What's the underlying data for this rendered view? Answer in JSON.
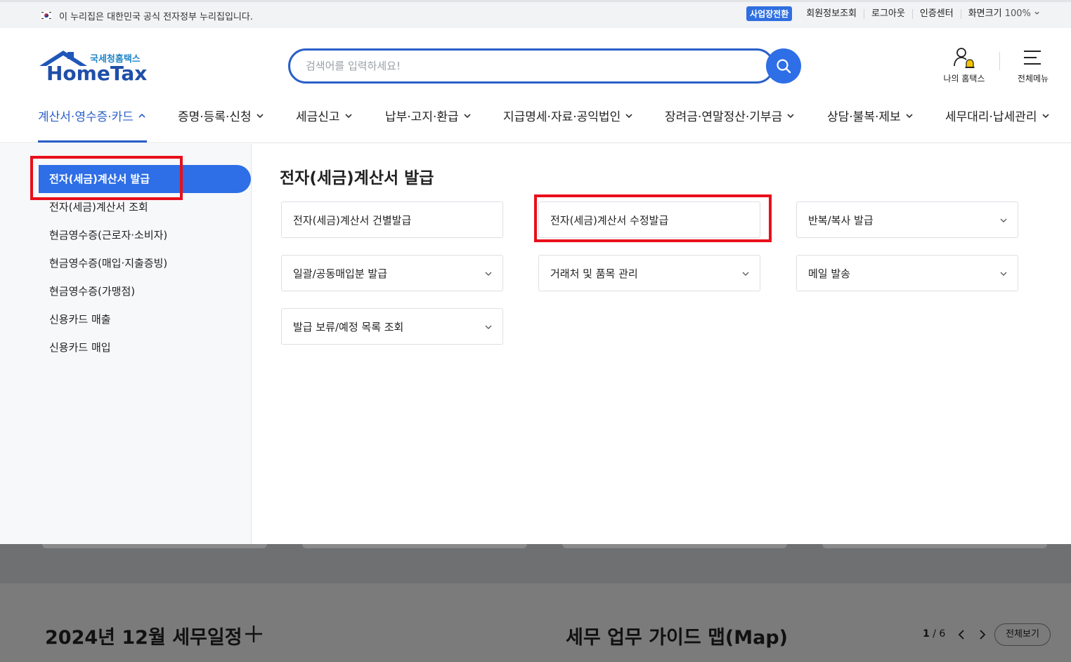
{
  "gov_bar": {
    "notice": "이 누리집은 대한민국 공식 전자정부 누리집입니다.",
    "switch_label": "사업장전환",
    "links": [
      "회원정보조회",
      "로그아웃",
      "인증센터"
    ],
    "zoom_label": "화면크기",
    "zoom_value": "100%"
  },
  "header": {
    "logo_sub": "국세청홈택스",
    "logo_main": "HomeTax",
    "search_placeholder": "검색어를 입력하세요!",
    "my_hometax": "나의 홈택스",
    "all_menu": "전체메뉴"
  },
  "nav": {
    "items": [
      {
        "label": "계산서·영수증·카드",
        "active": true
      },
      {
        "label": "증명·등록·신청"
      },
      {
        "label": "세금신고"
      },
      {
        "label": "납부·고지·환급"
      },
      {
        "label": "지급명세·자료·공익법인"
      },
      {
        "label": "장려금·연말정산·기부금"
      },
      {
        "label": "상담·불복·제보"
      },
      {
        "label": "세무대리·납세관리"
      }
    ]
  },
  "sidebar": {
    "items": [
      {
        "label": "전자(세금)계산서 발급",
        "active": true
      },
      {
        "label": "전자(세금)계산서 조회"
      },
      {
        "label": "현금영수증(근로자·소비자)"
      },
      {
        "label": "현금영수증(매입·지출증빙)"
      },
      {
        "label": "현금영수증(가맹점)"
      },
      {
        "label": "신용카드 매출"
      },
      {
        "label": "신용카드 매입"
      }
    ]
  },
  "main": {
    "title": "전자(세금)계산서 발급",
    "cards": [
      {
        "label": "전자(세금)계산서 건별발급"
      },
      {
        "label": "전자(세금)계산서 수정발급"
      },
      {
        "label": "반복/복사 발급"
      },
      {
        "label": "일괄/공동매입분 발급"
      },
      {
        "label": "거래처 및 품목 관리"
      },
      {
        "label": "메일 발송"
      },
      {
        "label": "발급 보류/예정 목록 조회"
      }
    ]
  },
  "bottom": {
    "schedule_title": "2024년 12월 세무일정",
    "guide_title": "세무 업무 가이드 맵(Map)",
    "page_current": "1",
    "page_total": "/ 6",
    "view_all": "전체보기"
  },
  "colors": {
    "brand_blue": "#2e6ee6",
    "highlight_red": "#e8101a"
  }
}
